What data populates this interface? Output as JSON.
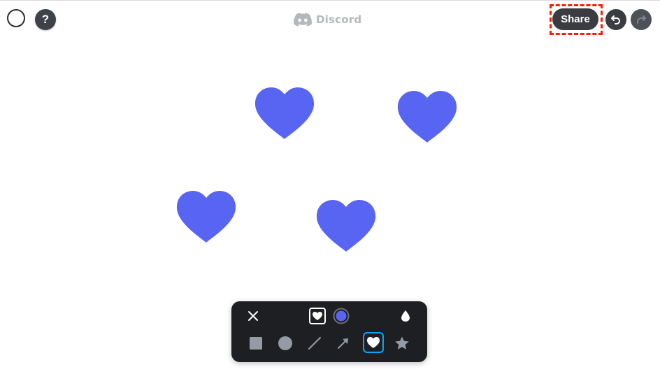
{
  "header": {
    "brand_label": "Discord",
    "help_label": "?",
    "share_label": "Share"
  },
  "canvas": {
    "shape": "heart",
    "shape_color": "#5865f2",
    "shape_count": 4
  },
  "toolbar": {
    "close_icon": "close-icon",
    "selected_shape_icon": "heart-icon",
    "selected_color": "#5865f2",
    "opacity_icon": "droplet-icon",
    "tools": [
      "square",
      "circle",
      "line",
      "arrow",
      "heart",
      "star"
    ],
    "active_tool": "heart"
  },
  "colors": {
    "accent": "#5865f2",
    "highlight": "#ff1a00",
    "toolbar_bg": "#1e1f22",
    "selected_outline": "#00a8fc"
  }
}
